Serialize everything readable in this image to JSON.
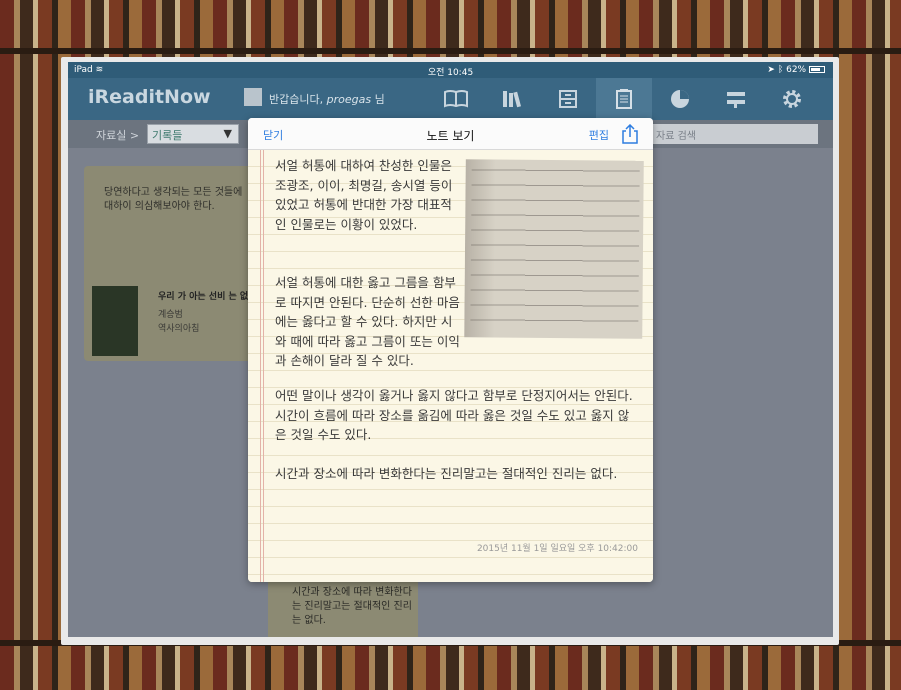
{
  "statusbar": {
    "device": "iPad",
    "time": "오전 10:45",
    "battery": "62%"
  },
  "appbar": {
    "brand": "iReaditNow",
    "greeting_prefix": "반갑습니다,",
    "username": "proegas",
    "greeting_suffix": "님",
    "nav_icons": [
      "book-icon",
      "library-icon",
      "archive-icon",
      "notes-icon",
      "pie-chart-icon",
      "settings-sliders-icon",
      "gear-icon"
    ]
  },
  "toolbar": {
    "crumb": "자료실 >",
    "folder": "기록들",
    "search_placeholder": "자료 검색"
  },
  "background_cards": {
    "card1_quote": "당연하다고 생각되는 모든 것들에 대하이 의심해보아야 한다.",
    "card1_book_title": "우리 가 아는 선비 는 없다",
    "card1_author": "계승범",
    "card1_publisher": "역사의아침",
    "card2_text": "시간과 장소에 따라 변화한다는 진리말고는 절대적인 진리는 없다."
  },
  "modal": {
    "close_label": "닫기",
    "title": "노트 보기",
    "edit_label": "편집",
    "paragraphs": [
      "서얼 허통에 대하여 찬성한 인물은 조광조, 이이, 최명길, 송시열 등이 있었고 허통에 반대한 가장 대표적인 인물로는 이황이 있었다.",
      "서얼 허통에 대한 옳고 그름을 함부로 따지면 안된다. 단순히 선한 마음에는 옳다고 할 수 있다. 하지만 시와 때에 따라 옳고 그름이 또는 이익과 손해이 달라 질 수 있다.",
      "어떤 말이나 생각이 옳거나 옳지 않다고 함부로 단정지어서는 안된다. 시간이 흐름에 따라 장소를 옮김에 따라 옳은 것일 수도 있고 옳지 않은 것일 수도 있다.",
      "시간과 장소에 따라 변화한다는 진리말고는 절대적인 진리는 없다."
    ],
    "timestamp": "2015년 11월 1일 일요일 오후 10:42:00"
  }
}
